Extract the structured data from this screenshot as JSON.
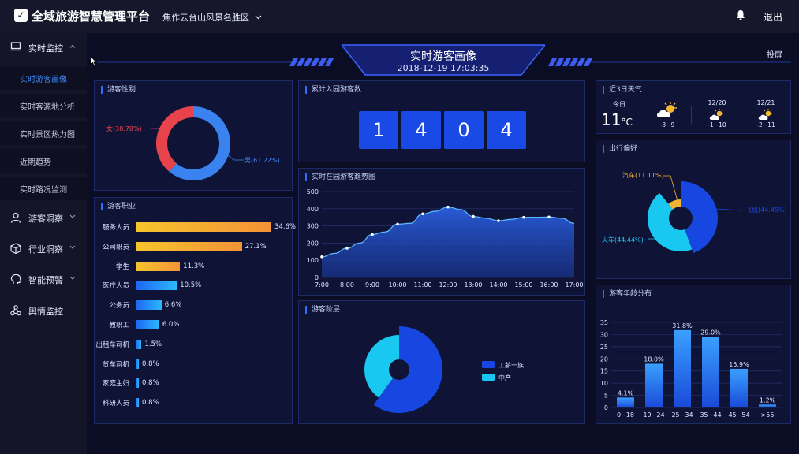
{
  "header": {
    "app_title": "全域旅游智慧管理平台",
    "scenic_area": "焦作云台山风景名胜区",
    "logout": "退出"
  },
  "sidebar": {
    "groups": [
      {
        "label": "实时监控",
        "icon": "monitor-icon"
      },
      {
        "label": "游客洞察",
        "icon": "person-icon"
      },
      {
        "label": "行业洞察",
        "icon": "cube-icon"
      },
      {
        "label": "智能预警",
        "icon": "brain-icon"
      },
      {
        "label": "舆情监控",
        "icon": "cluster-icon"
      }
    ],
    "sub_items": [
      {
        "label": "实时游客画像",
        "active": true
      },
      {
        "label": "实时客源地分析"
      },
      {
        "label": "实时景区热力图"
      },
      {
        "label": "近期趋势"
      },
      {
        "label": "实时路况监测"
      }
    ]
  },
  "main": {
    "title": "实时游客画像",
    "datetime": "2018-12-19 17:03:35",
    "cast": "投屏"
  },
  "colors": {
    "accent": "#2c6cff",
    "panel_bg": "#0f1437",
    "male": "#3a82f0",
    "female": "#e8434d",
    "cyan": "#19c8f0",
    "deep_blue": "#1747e0",
    "orange": "#f2b233"
  },
  "gender": {
    "title": "游客性别",
    "female_label": "女(38.78%)",
    "male_label": "男(61.22%)",
    "female": 38.78,
    "male": 61.22
  },
  "counter": {
    "title": "累计入园游客数",
    "digits": [
      "1",
      "4",
      "0",
      "4"
    ]
  },
  "weather": {
    "title": "近3日天气",
    "today_label": "今日",
    "today_temp": "11",
    "unit": "°C",
    "days": [
      {
        "date": "",
        "range": "-3~9",
        "icon": "sun-cloud-icon"
      },
      {
        "date": "12/20",
        "range": "-1~10",
        "icon": "sun-cloud-icon"
      },
      {
        "date": "12/21",
        "range": "-2~11",
        "icon": "sun-cloud-icon"
      }
    ]
  },
  "occupation": {
    "title": "游客职业",
    "rows": [
      {
        "label": "服务人员",
        "value": 34.6,
        "text": "34.6%"
      },
      {
        "label": "公司职员",
        "value": 27.1,
        "text": "27.1%"
      },
      {
        "label": "学生",
        "value": 11.3,
        "text": "11.3%"
      },
      {
        "label": "医疗人员",
        "value": 10.5,
        "text": "10.5%"
      },
      {
        "label": "公务员",
        "value": 6.6,
        "text": "6.6%"
      },
      {
        "label": "教职工",
        "value": 6.0,
        "text": "6.0%"
      },
      {
        "label": "出租车司机",
        "value": 1.5,
        "text": "1.5%"
      },
      {
        "label": "货车司机",
        "value": 0.8,
        "text": "0.8%"
      },
      {
        "label": "家庭主妇",
        "value": 0.8,
        "text": "0.8%"
      },
      {
        "label": "科研人员",
        "value": 0.8,
        "text": "0.8%"
      }
    ]
  },
  "trend": {
    "title": "实时在园游客趋势图",
    "chart_data": {
      "type": "area",
      "x": [
        "7:00",
        "7:30",
        "8:00",
        "8:30",
        "9:00",
        "9:30",
        "10:00",
        "10:30",
        "11:00",
        "11:30",
        "12:00",
        "12:30",
        "13:00",
        "13:30",
        "14:00",
        "14:30",
        "15:00",
        "15:30",
        "16:00",
        "16:30",
        "17:00"
      ],
      "tick_labels": [
        "7:00",
        "8:00",
        "9:00",
        "10:00",
        "11:00",
        "12:00",
        "13:00",
        "14:00",
        "15:00",
        "16:00",
        "17:00"
      ],
      "values": [
        120,
        140,
        170,
        200,
        250,
        265,
        310,
        315,
        370,
        385,
        410,
        395,
        355,
        345,
        330,
        338,
        350,
        350,
        352,
        345,
        315
      ],
      "markers": [
        0,
        2,
        4,
        6,
        8,
        10,
        12,
        14,
        16,
        18
      ],
      "ylim": [
        0,
        500
      ],
      "yticks": [
        0,
        100,
        200,
        300,
        400,
        500
      ],
      "grid": true
    }
  },
  "travel": {
    "title": "出行偏好",
    "chart_data": {
      "type": "pie",
      "labels": [
        "飞机(44.45%)",
        "火车(44.44%)",
        "汽车(11.11%)"
      ],
      "values": [
        44.45,
        44.44,
        11.11
      ]
    }
  },
  "level": {
    "title": "游客阶层",
    "chart_data": {
      "type": "pie",
      "labels": [
        "工薪一族",
        "中产"
      ],
      "values": [
        60,
        40
      ]
    }
  },
  "age": {
    "title": "游客年龄分布",
    "chart_data": {
      "type": "bar",
      "categories": [
        "0~18",
        "19~24",
        "25~34",
        "35~44",
        "45~54",
        ">55"
      ],
      "values": [
        4.1,
        18.0,
        31.8,
        29.0,
        15.9,
        1.2
      ],
      "value_labels": [
        "4.1%",
        "18.0%",
        "31.8%",
        "29.0%",
        "15.9%",
        "1.2%"
      ],
      "ylim": [
        0,
        35
      ],
      "yticks": [
        0,
        5,
        10,
        15,
        20,
        25,
        30,
        35
      ],
      "grid": true
    }
  }
}
